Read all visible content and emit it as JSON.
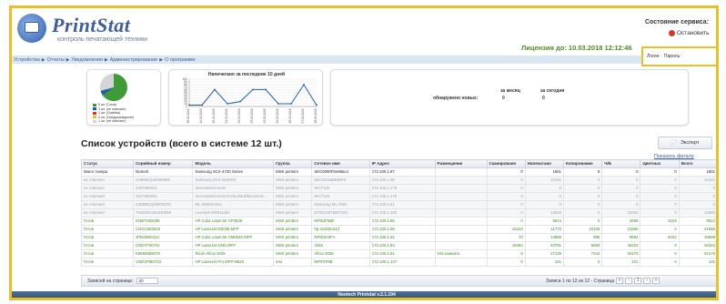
{
  "app": {
    "brand": "PrintStat",
    "tagline": "контроль печатающей техники",
    "license": "Лицензия до: 10.03.2018 12:12:46",
    "server_title": "Состояние сервиса:",
    "stop_label": "Остановить",
    "footer": "Nootech Printstat v.2.1.104"
  },
  "login": {
    "field1": "Логин:",
    "field2": "Пароль:"
  },
  "nav": [
    "Устройства",
    "Отчеты",
    "Уведомления",
    "Администрирование",
    "О программе"
  ],
  "dashboard": {
    "pie_legend": [
      {
        "label": "5 шт. (Готов)",
        "color": "#3f9a3a"
      },
      {
        "label": "3 шт. (не отвечает)",
        "color": "#1f5fa8"
      },
      {
        "label": "1 шт. (Ошибка)",
        "color": "#d43a2a"
      },
      {
        "label": "0 шт. (Предупреждение)",
        "color": "#e6c22a"
      },
      {
        "label": "1 шт. (не отвечает)",
        "color": "#d5d5d5"
      }
    ],
    "line_chart_title": "Напечатано за последние 10 дней",
    "found_label": "обнаружено новых:",
    "month_label": "за месяц",
    "today_label": "за сегодня",
    "month_value": "0",
    "today_value": "0"
  },
  "chart_data": {
    "type": "line",
    "title": "Напечатано за последние 10 дней",
    "x": [
      "18.09.2016",
      "19.09.2016",
      "20.09.2016",
      "21.09.2016",
      "22.09.2016",
      "23.09.2016",
      "24.09.2016",
      "25.09.2016",
      "26.09.2016",
      "27.09.2016",
      "28.09.2016"
    ],
    "series": [
      {
        "values": [
          5,
          5,
          62,
          10,
          18,
          62,
          62,
          10,
          10,
          80,
          5
        ]
      }
    ],
    "yticks": [
      "0",
      "10",
      "20",
      "30",
      "40",
      "50",
      "60",
      "70",
      "80",
      "90",
      "100"
    ],
    "ylim": [
      0,
      100
    ],
    "grid": true
  },
  "section": {
    "title": "Список устройств (всего в системе 12 шт.)",
    "export_label": "Экспорт",
    "filter_link": "Показать фильтр"
  },
  "table": {
    "columns": [
      "Статус",
      "Серийный номер",
      "Модель",
      "Группа",
      "Сетевое имя",
      "IP Адрес",
      "Размещение",
      "Сканировано",
      "Напечатано",
      "Копирование",
      "Ч/Б",
      "Цветных",
      "Всего"
    ],
    "rows": [
      {
        "status": "mfp",
        "cells": [
          "Мало тонера",
          "NoSent",
          "Samsung SCX-4720 Series",
          "MSK printers",
          "SEC0000F0e88ac4",
          "172.100.1.87",
          "",
          "0",
          "1801",
          "0",
          "0",
          "0",
          "1801"
        ]
      },
      {
        "status": "offline",
        "cells": [
          "не отвечает",
          "XU8981QJ005000K",
          "Samsung SCX-5530FN",
          "MSK printers",
          "SEC0015BB0DF0",
          "172.100.1.60",
          "",
          "0",
          "10161",
          "0",
          "0",
          "0",
          "10161"
        ]
      },
      {
        "status": "offline",
        "cells": [
          "не отвечает",
          "3327680021",
          "XeroxWorkCentre",
          "MSK printers",
          "WC7120",
          "172.100.1.178",
          "",
          "0",
          "0",
          "0",
          "0",
          "0",
          "0"
        ]
      },
      {
        "status": "offline",
        "cells": [
          "не отвечает",
          "3327680021",
          "XeroxWorkCentre7220v1MultifunctionS...",
          "MSK printers",
          "WC7120",
          "172.100.1.178",
          "",
          "0",
          "0",
          "0",
          "0",
          "0",
          "0"
        ]
      },
      {
        "status": "offline",
        "cells": [
          "не отвечает",
          "Z4BBB1QJ600007N",
          "ML-3050Series",
          "MSK printers",
          "Samsung ML-3051",
          "172.100.2.51",
          "",
          "0",
          "0",
          "0",
          "0",
          "0",
          "0"
        ]
      },
      {
        "status": "offline",
        "cells": [
          "не отвечает",
          "7619Z8A401630590",
          "Lexmark MX511dhe",
          "MSK printers",
          "ET0021B7BEFCB1",
          "172.100.1.182",
          "",
          "0",
          "12660",
          "0",
          "12660",
          "0",
          "12660"
        ]
      },
      {
        "status": "ready",
        "cells": [
          "Готов",
          "CNBTS92005",
          "HP Color LaserJet CP3525",
          "MSK printers",
          "NPI54F6BF",
          "172.100.1.85",
          "",
          "0",
          "5914",
          "0",
          "2685",
          "3229",
          "5914"
        ]
      },
      {
        "status": "ready",
        "cells": [
          "Готов",
          "CNGC920018",
          "HP LaserJet M3035 MFP",
          "MSK printers",
          "hp-m3035-512",
          "172.100.1.86",
          "",
          "15103",
          "11770",
          "10106",
          "21866",
          "0",
          "21866"
        ]
      },
      {
        "status": "ready",
        "cells": [
          "Готов",
          "JPDXB00414",
          "HP Color LaserJet CM6040 MFP",
          "MSK printers",
          "NPID3A0FA",
          "172.100.1.62",
          "",
          "70",
          "14889",
          "895",
          "9594",
          "6162",
          "15888"
        ]
      },
      {
        "status": "ready",
        "cells": [
          "Готов",
          "CNDYF00721",
          "HP LaserJet 4345 MFP",
          "MSK printers",
          "4345",
          "172.100.1.83",
          "",
          "19464",
          "40791",
          "5593",
          "46324",
          "0",
          "46324"
        ]
      },
      {
        "status": "ready",
        "cells": [
          "Готов",
          "K8665606078",
          "Ricoh Aficio 3025",
          "MSK printers",
          "Aficio 3025",
          "172.100.1.81",
          "515 комната",
          "0",
          "27128",
          "7342",
          "34170",
          "0",
          "34170"
        ]
      },
      {
        "status": "ready",
        "cells": [
          "Готов",
          "VNDVF8DYC0",
          "HP LaserJet Pro MFP M525",
          "test",
          "NPIF0F8B",
          "172.100.1.147",
          "",
          "0",
          "101",
          "0",
          "101",
          "0",
          "101"
        ]
      }
    ]
  },
  "pager": {
    "per_page_label": "Записей на странице:",
    "per_page_value": "20",
    "range_text": "Записи 1 по 12 из 12 - Страница",
    "page": "1"
  }
}
